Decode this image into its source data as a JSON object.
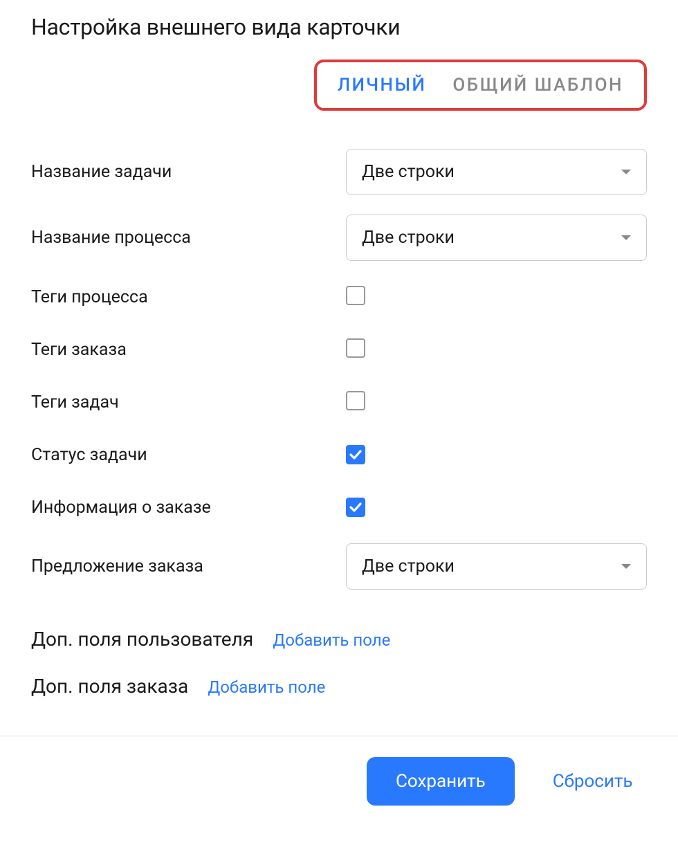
{
  "title": "Настройка внешнего вида карточки",
  "tabs": {
    "personal": "ЛИЧНЫЙ",
    "shared": "ОБЩИЙ ШАБЛОН"
  },
  "fields": {
    "task_name": {
      "label": "Название задачи",
      "value": "Две строки"
    },
    "process_name": {
      "label": "Название процесса",
      "value": "Две строки"
    },
    "process_tags": {
      "label": "Теги процесса",
      "checked": false
    },
    "order_tags": {
      "label": "Теги заказа",
      "checked": false
    },
    "task_tags": {
      "label": "Теги задач",
      "checked": false
    },
    "task_status": {
      "label": "Статус задачи",
      "checked": true
    },
    "order_info": {
      "label": "Информация о заказе",
      "checked": true
    },
    "order_offer": {
      "label": "Предложение заказа",
      "value": "Две строки"
    }
  },
  "sections": {
    "user_fields": {
      "label": "Доп. поля пользователя",
      "action": "Добавить поле"
    },
    "order_fields": {
      "label": "Доп. поля заказа",
      "action": "Добавить поле"
    }
  },
  "footer": {
    "save": "Сохранить",
    "reset": "Сбросить"
  }
}
